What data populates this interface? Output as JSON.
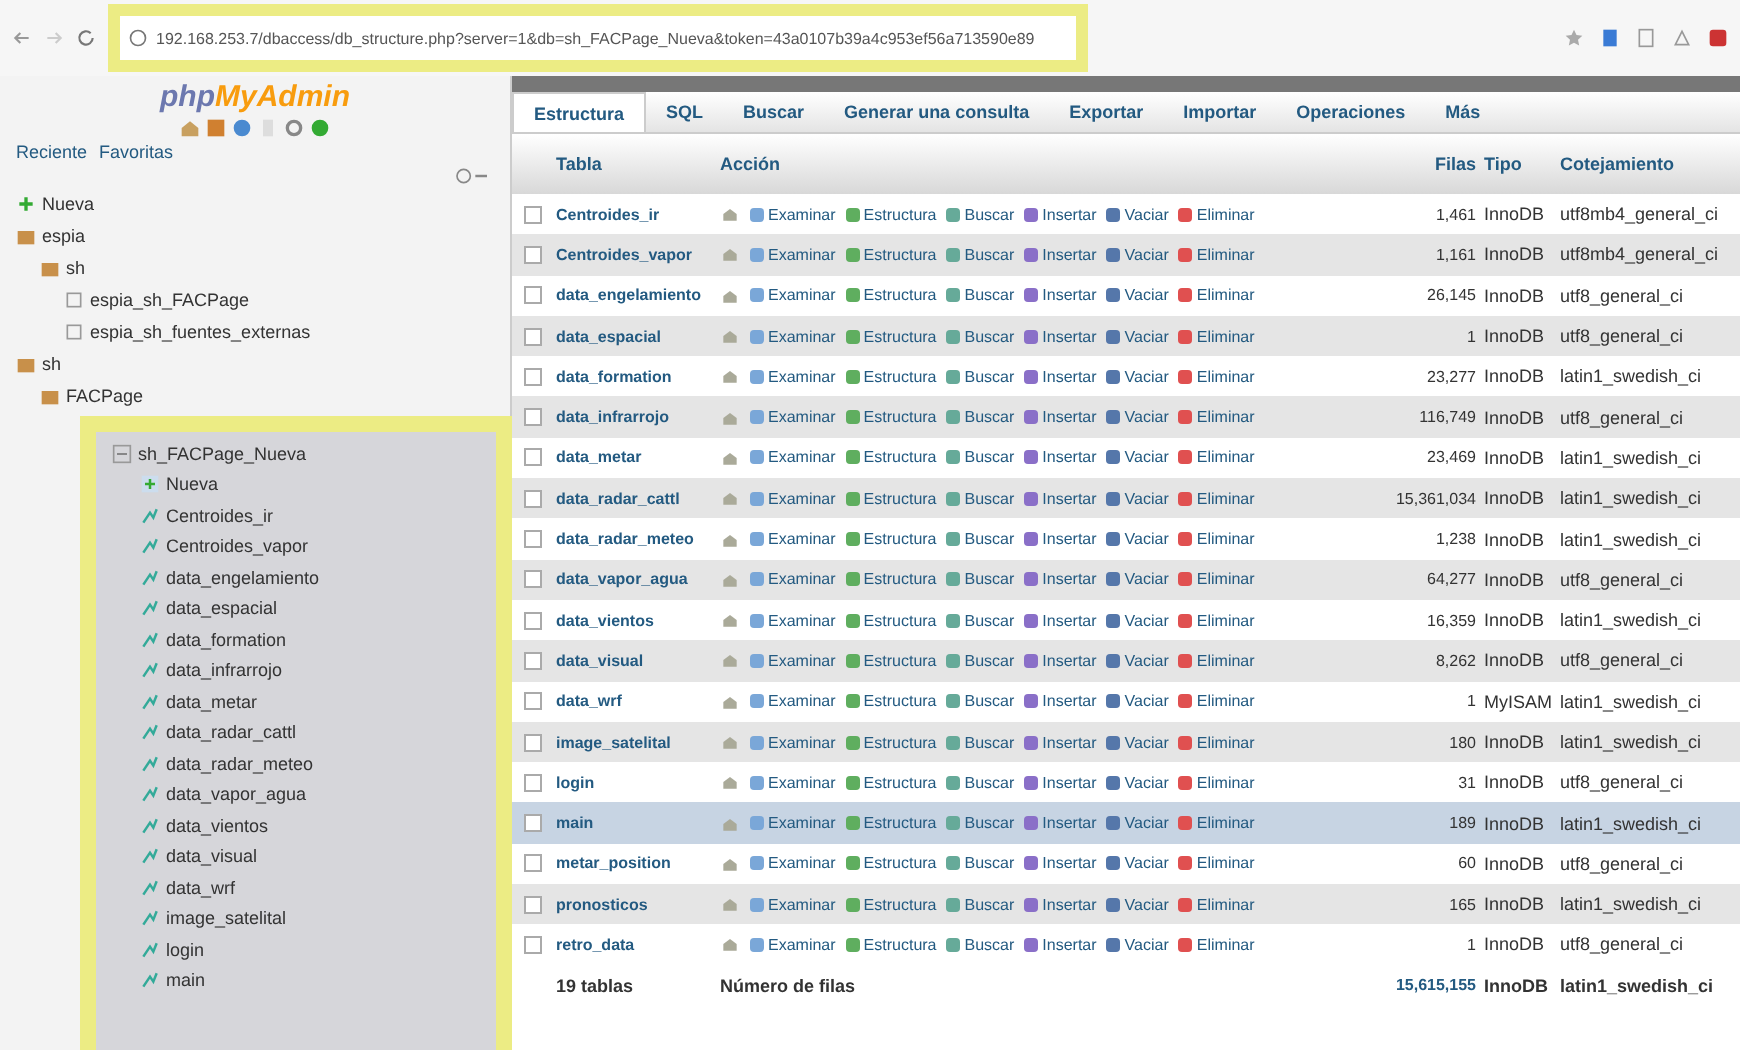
{
  "browser": {
    "url": "192.168.253.7/dbaccess/db_structure.php?server=1&db=sh_FACPage_Nueva&token=43a0107b39a4c953ef56a713590e89"
  },
  "sidebar": {
    "logo_a": "php",
    "logo_b": "MyAdmin",
    "links": [
      "Reciente",
      "Favoritas"
    ],
    "tree": [
      {
        "name": "Nueva",
        "kind": "new"
      },
      {
        "name": "espia",
        "kind": "db",
        "children": [
          {
            "name": "sh",
            "kind": "db",
            "children": [
              {
                "name": "espia_sh_FACPage",
                "kind": "table"
              },
              {
                "name": "espia_sh_fuentes_externas",
                "kind": "table"
              }
            ]
          }
        ]
      },
      {
        "name": "sh",
        "kind": "db",
        "children": [
          {
            "name": "FACPage",
            "kind": "db"
          }
        ]
      }
    ],
    "highlighted": {
      "name": "sh_FACPage_Nueva",
      "kind": "db",
      "children": [
        {
          "name": "Nueva",
          "kind": "new"
        },
        {
          "name": "Centroides_ir",
          "kind": "table"
        },
        {
          "name": "Centroides_vapor",
          "kind": "table"
        },
        {
          "name": "data_engelamiento",
          "kind": "table"
        },
        {
          "name": "data_espacial",
          "kind": "table"
        },
        {
          "name": "data_formation",
          "kind": "table"
        },
        {
          "name": "data_infrarrojo",
          "kind": "table"
        },
        {
          "name": "data_metar",
          "kind": "table"
        },
        {
          "name": "data_radar_cattl",
          "kind": "table"
        },
        {
          "name": "data_radar_meteo",
          "kind": "table"
        },
        {
          "name": "data_vapor_agua",
          "kind": "table"
        },
        {
          "name": "data_vientos",
          "kind": "table"
        },
        {
          "name": "data_visual",
          "kind": "table"
        },
        {
          "name": "data_wrf",
          "kind": "table"
        },
        {
          "name": "image_satelital",
          "kind": "table"
        },
        {
          "name": "login",
          "kind": "table"
        },
        {
          "name": "main",
          "kind": "table"
        }
      ]
    }
  },
  "tabs": [
    {
      "label": "Estructura",
      "selected": true
    },
    {
      "label": "SQL",
      "selected": false
    },
    {
      "label": "Buscar",
      "selected": false
    },
    {
      "label": "Generar una consulta",
      "selected": false
    },
    {
      "label": "Exportar",
      "selected": false
    },
    {
      "label": "Importar",
      "selected": false
    },
    {
      "label": "Operaciones",
      "selected": false
    },
    {
      "label": "Más",
      "selected": false
    }
  ],
  "table": {
    "columns": [
      "Tabla",
      "Acción",
      "Filas",
      "Tipo",
      "Cotejamiento"
    ],
    "rows": [
      {
        "name": "Centroides_ir",
        "actions": [
          "Examinar",
          "Estructura",
          "Buscar",
          "Insertar",
          "Vaciar",
          "Eliminar"
        ],
        "rows": "1,461",
        "type": "InnoDB",
        "collation": "utf8mb4_general_ci",
        "selected": false
      },
      {
        "name": "Centroides_vapor",
        "actions": [
          "Examinar",
          "Estructura",
          "Buscar",
          "Insertar",
          "Vaciar",
          "Eliminar"
        ],
        "rows": "1,161",
        "type": "InnoDB",
        "collation": "utf8mb4_general_ci",
        "selected": false
      },
      {
        "name": "data_engelamiento",
        "actions": [
          "Examinar",
          "Estructura",
          "Buscar",
          "Insertar",
          "Vaciar",
          "Eliminar"
        ],
        "rows": "26,145",
        "type": "InnoDB",
        "collation": "utf8_general_ci",
        "selected": false
      },
      {
        "name": "data_espacial",
        "actions": [
          "Examinar",
          "Estructura",
          "Buscar",
          "Insertar",
          "Vaciar",
          "Eliminar"
        ],
        "rows": "1",
        "type": "InnoDB",
        "collation": "utf8_general_ci",
        "selected": false
      },
      {
        "name": "data_formation",
        "actions": [
          "Examinar",
          "Estructura",
          "Buscar",
          "Insertar",
          "Vaciar",
          "Eliminar"
        ],
        "rows": "23,277",
        "type": "InnoDB",
        "collation": "latin1_swedish_ci",
        "selected": false
      },
      {
        "name": "data_infrarrojo",
        "actions": [
          "Examinar",
          "Estructura",
          "Buscar",
          "Insertar",
          "Vaciar",
          "Eliminar"
        ],
        "rows": "116,749",
        "type": "InnoDB",
        "collation": "utf8_general_ci",
        "selected": false
      },
      {
        "name": "data_metar",
        "actions": [
          "Examinar",
          "Estructura",
          "Buscar",
          "Insertar",
          "Vaciar",
          "Eliminar"
        ],
        "rows": "23,469",
        "type": "InnoDB",
        "collation": "latin1_swedish_ci",
        "selected": false
      },
      {
        "name": "data_radar_cattl",
        "actions": [
          "Examinar",
          "Estructura",
          "Buscar",
          "Insertar",
          "Vaciar",
          "Eliminar"
        ],
        "rows": "15,361,034",
        "type": "InnoDB",
        "collation": "latin1_swedish_ci",
        "selected": false
      },
      {
        "name": "data_radar_meteo",
        "actions": [
          "Examinar",
          "Estructura",
          "Buscar",
          "Insertar",
          "Vaciar",
          "Eliminar"
        ],
        "rows": "1,238",
        "type": "InnoDB",
        "collation": "latin1_swedish_ci",
        "selected": false
      },
      {
        "name": "data_vapor_agua",
        "actions": [
          "Examinar",
          "Estructura",
          "Buscar",
          "Insertar",
          "Vaciar",
          "Eliminar"
        ],
        "rows": "64,277",
        "type": "InnoDB",
        "collation": "utf8_general_ci",
        "selected": false
      },
      {
        "name": "data_vientos",
        "actions": [
          "Examinar",
          "Estructura",
          "Buscar",
          "Insertar",
          "Vaciar",
          "Eliminar"
        ],
        "rows": "16,359",
        "type": "InnoDB",
        "collation": "latin1_swedish_ci",
        "selected": false
      },
      {
        "name": "data_visual",
        "actions": [
          "Examinar",
          "Estructura",
          "Buscar",
          "Insertar",
          "Vaciar",
          "Eliminar"
        ],
        "rows": "8,262",
        "type": "InnoDB",
        "collation": "utf8_general_ci",
        "selected": false
      },
      {
        "name": "data_wrf",
        "actions": [
          "Examinar",
          "Estructura",
          "Buscar",
          "Insertar",
          "Vaciar",
          "Eliminar"
        ],
        "rows": "1",
        "type": "MyISAM",
        "collation": "latin1_swedish_ci",
        "selected": false
      },
      {
        "name": "image_satelital",
        "actions": [
          "Examinar",
          "Estructura",
          "Buscar",
          "Insertar",
          "Vaciar",
          "Eliminar"
        ],
        "rows": "180",
        "type": "InnoDB",
        "collation": "latin1_swedish_ci",
        "selected": false
      },
      {
        "name": "login",
        "actions": [
          "Examinar",
          "Estructura",
          "Buscar",
          "Insertar",
          "Vaciar",
          "Eliminar"
        ],
        "rows": "31",
        "type": "InnoDB",
        "collation": "utf8_general_ci",
        "selected": false
      },
      {
        "name": "main",
        "actions": [
          "Examinar",
          "Estructura",
          "Buscar",
          "Insertar",
          "Vaciar",
          "Eliminar"
        ],
        "rows": "189",
        "type": "InnoDB",
        "collation": "latin1_swedish_ci",
        "selected": true
      },
      {
        "name": "metar_position",
        "actions": [
          "Examinar",
          "Estructura",
          "Buscar",
          "Insertar",
          "Vaciar",
          "Eliminar"
        ],
        "rows": "60",
        "type": "InnoDB",
        "collation": "utf8_general_ci",
        "selected": false
      },
      {
        "name": "pronosticos",
        "actions": [
          "Examinar",
          "Estructura",
          "Buscar",
          "Insertar",
          "Vaciar",
          "Eliminar"
        ],
        "rows": "165",
        "type": "InnoDB",
        "collation": "latin1_swedish_ci",
        "selected": false
      },
      {
        "name": "retro_data",
        "actions": [
          "Examinar",
          "Estructura",
          "Buscar",
          "Insertar",
          "Vaciar",
          "Eliminar"
        ],
        "rows": "1",
        "type": "InnoDB",
        "collation": "utf8_general_ci",
        "selected": false
      }
    ],
    "footer": {
      "count": "19 tablas",
      "label": "Número de filas",
      "rows": "15,615,155",
      "type": "InnoDB",
      "collation": "latin1_swedish_ci"
    }
  }
}
